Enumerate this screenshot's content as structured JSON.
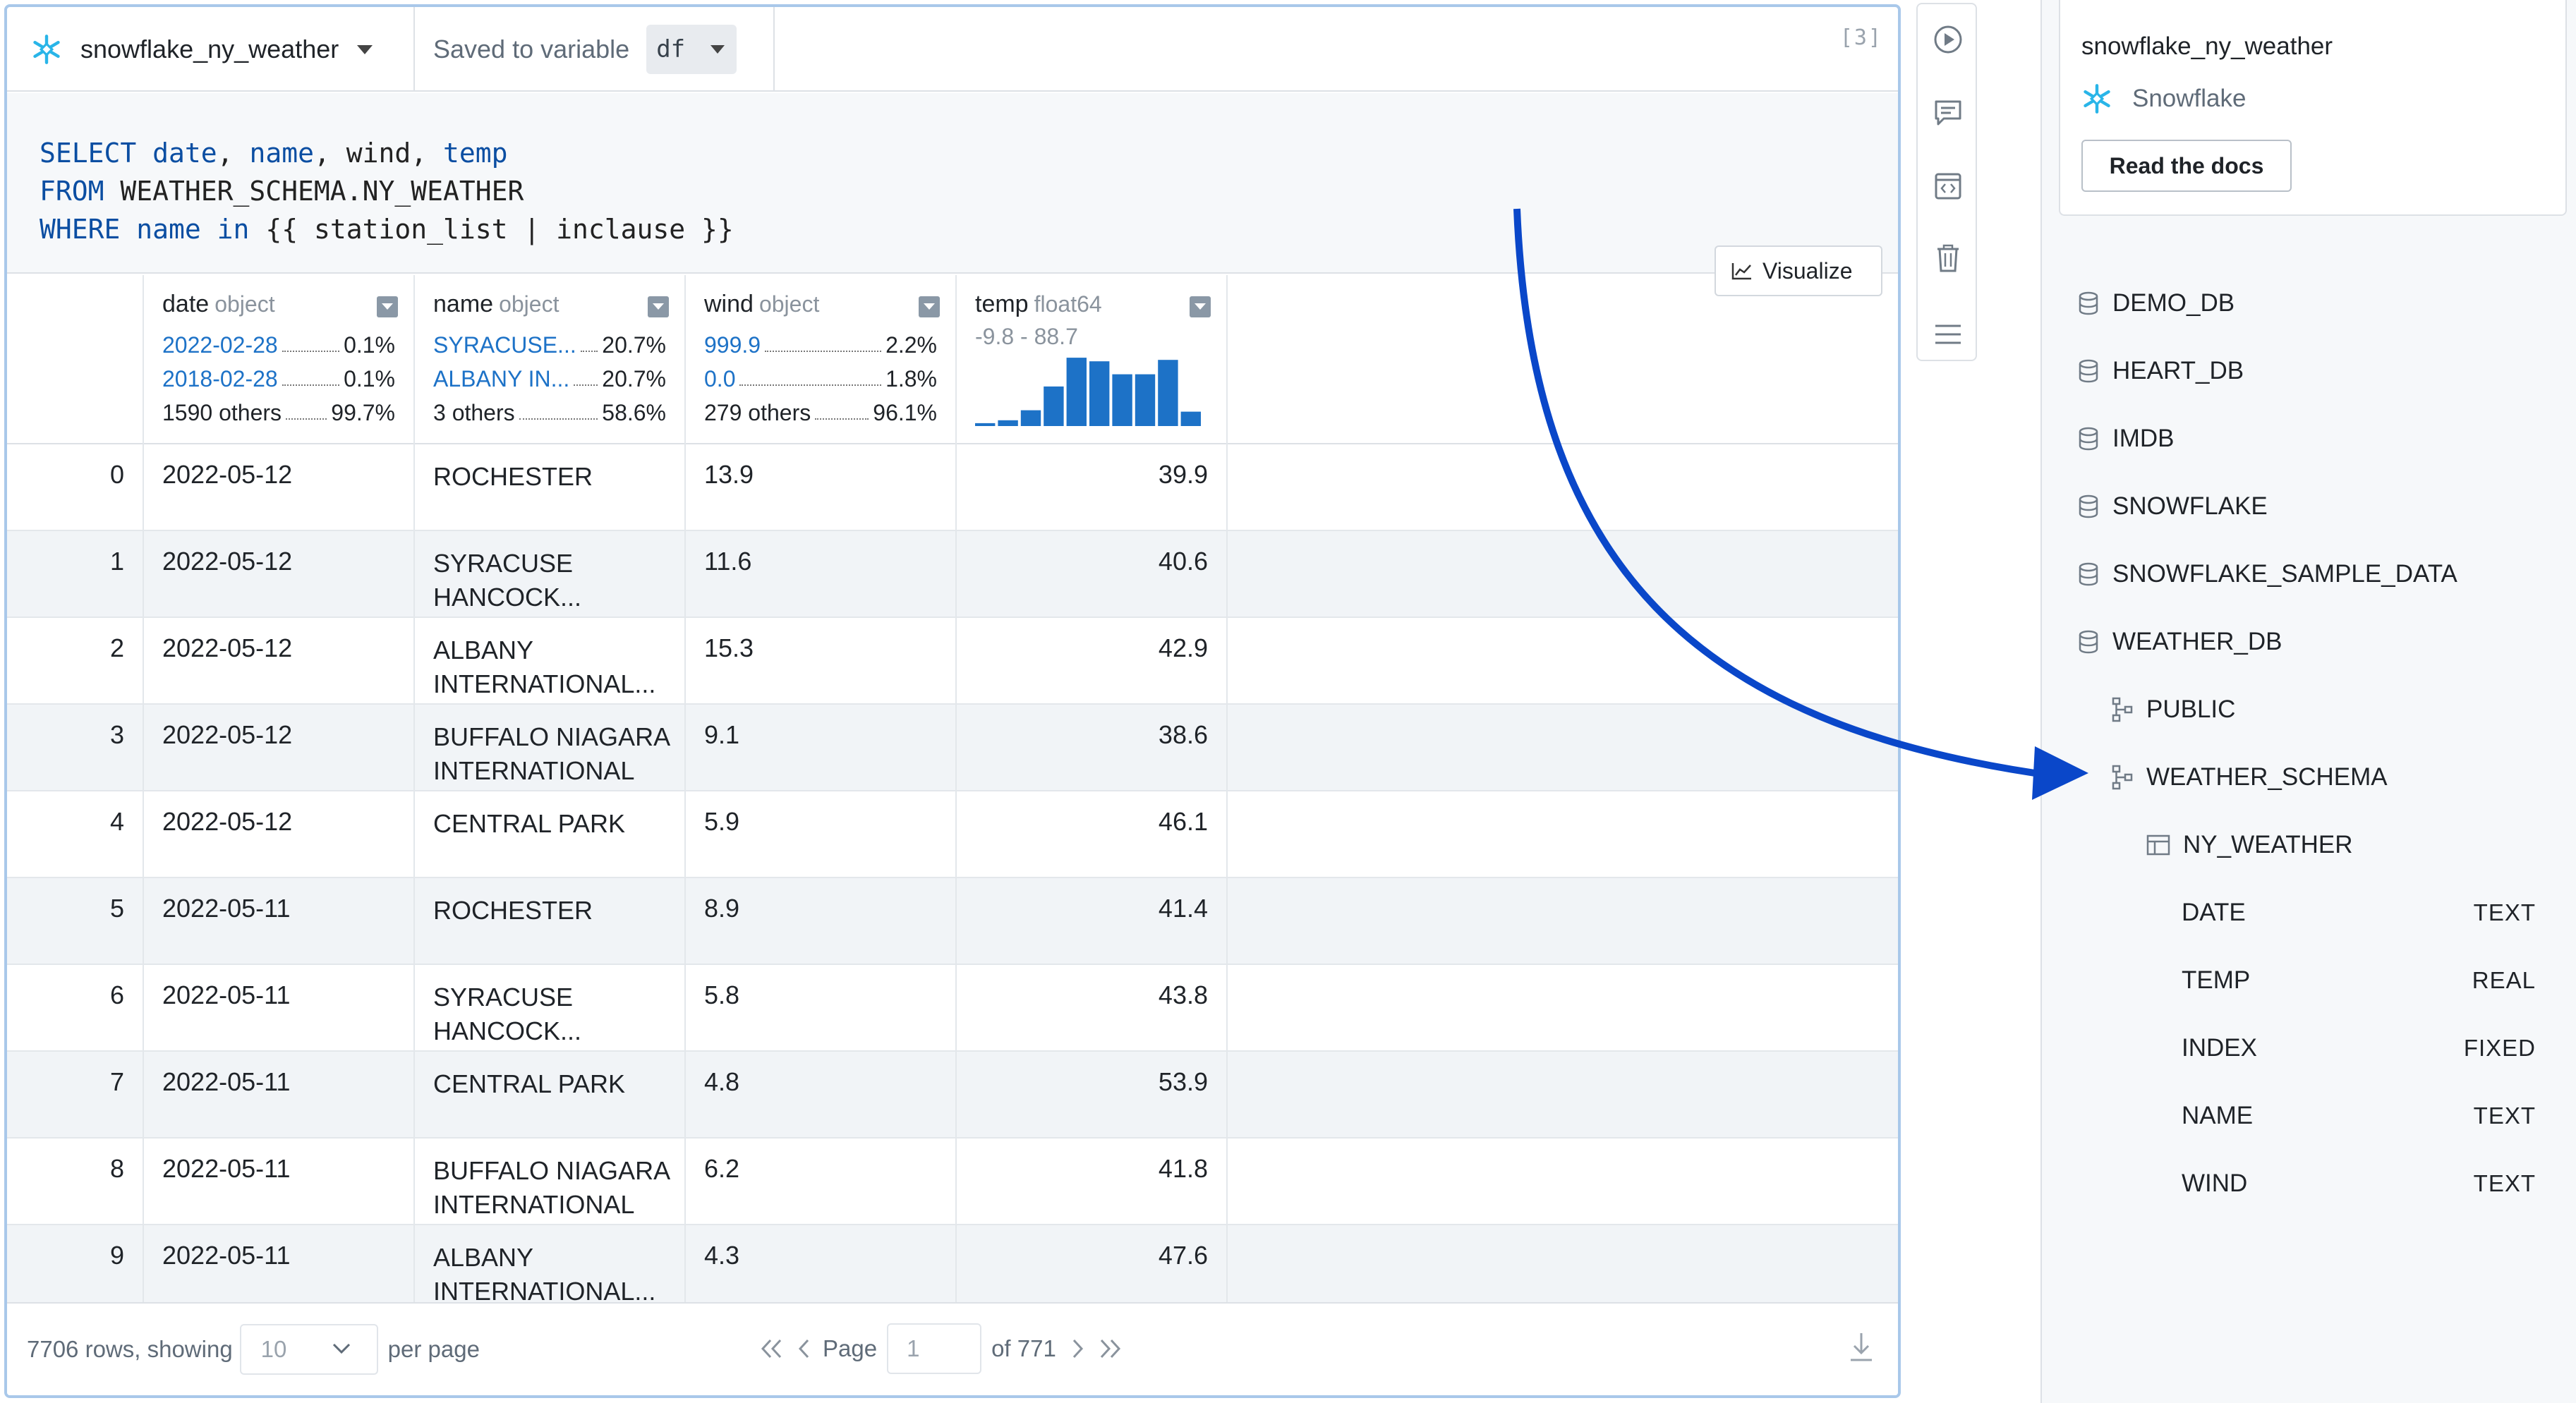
{
  "cell": {
    "source_name": "snowflake_ny_weather",
    "saved_to_label": "Saved to variable",
    "variable": "df",
    "exec_count": "[3]",
    "sql": {
      "line1": [
        "SELECT",
        " date",
        ", ",
        "name",
        ", wind, ",
        "temp"
      ],
      "line2": [
        "FROM",
        " WEATHER_SCHEMA.NY_WEATHER"
      ],
      "line3": [
        "WHERE",
        " name",
        " ",
        "in",
        " {{ station_list | inclause }}"
      ]
    },
    "visualize_label": "Visualize"
  },
  "table": {
    "columns": [
      {
        "name": "date",
        "dtype": "object",
        "stats": [
          {
            "label": "2022-02-28",
            "pct": "0.1%",
            "link": true
          },
          {
            "label": "2018-02-28",
            "pct": "0.1%",
            "link": true
          },
          {
            "label": "1590 others",
            "pct": "99.7%",
            "link": false
          }
        ]
      },
      {
        "name": "name",
        "dtype": "object",
        "stats": [
          {
            "label": "SYRACUSE...",
            "pct": "20.7%",
            "link": true
          },
          {
            "label": "ALBANY IN...",
            "pct": "20.7%",
            "link": true
          },
          {
            "label": "3 others",
            "pct": "58.6%",
            "link": false
          }
        ]
      },
      {
        "name": "wind",
        "dtype": "object",
        "stats": [
          {
            "label": "999.9",
            "pct": "2.2%",
            "link": true
          },
          {
            "label": "0.0",
            "pct": "1.8%",
            "link": true
          },
          {
            "label": "279 others",
            "pct": "96.1%",
            "link": false
          }
        ]
      },
      {
        "name": "temp",
        "dtype": "float64",
        "range": "-9.8 - 88.7"
      }
    ],
    "temp_histogram": [
      0.04,
      0.08,
      0.22,
      0.55,
      0.95,
      0.9,
      0.72,
      0.72,
      0.92,
      0.2
    ],
    "rows": [
      {
        "idx": "0",
        "date": "2022-05-12",
        "name1": "ROCHESTER",
        "name2": "",
        "wind": "13.9",
        "temp": "39.9"
      },
      {
        "idx": "1",
        "date": "2022-05-12",
        "name1": "SYRACUSE",
        "name2": "HANCOCK...",
        "wind": "11.6",
        "temp": "40.6"
      },
      {
        "idx": "2",
        "date": "2022-05-12",
        "name1": "ALBANY",
        "name2": "INTERNATIONAL...",
        "wind": "15.3",
        "temp": "42.9"
      },
      {
        "idx": "3",
        "date": "2022-05-12",
        "name1": "BUFFALO NIAGARA",
        "name2": "INTERNATIONAL",
        "wind": "9.1",
        "temp": "38.6"
      },
      {
        "idx": "4",
        "date": "2022-05-12",
        "name1": "CENTRAL PARK",
        "name2": "",
        "wind": "5.9",
        "temp": "46.1"
      },
      {
        "idx": "5",
        "date": "2022-05-11",
        "name1": "ROCHESTER",
        "name2": "",
        "wind": "8.9",
        "temp": "41.4"
      },
      {
        "idx": "6",
        "date": "2022-05-11",
        "name1": "SYRACUSE",
        "name2": "HANCOCK...",
        "wind": "5.8",
        "temp": "43.8"
      },
      {
        "idx": "7",
        "date": "2022-05-11",
        "name1": "CENTRAL PARK",
        "name2": "",
        "wind": "4.8",
        "temp": "53.9"
      },
      {
        "idx": "8",
        "date": "2022-05-11",
        "name1": "BUFFALO NIAGARA",
        "name2": "INTERNATIONAL",
        "wind": "6.2",
        "temp": "41.8"
      },
      {
        "idx": "9",
        "date": "2022-05-11",
        "name1": "ALBANY",
        "name2": "INTERNATIONAL...",
        "wind": "4.3",
        "temp": "47.6"
      }
    ],
    "footer": {
      "rows_info": "7706 rows, showing",
      "per_page": "10",
      "per_page_label": "per page",
      "page_label": "Page",
      "page": "1",
      "of_label": "of 771"
    }
  },
  "toolbar": {
    "icons": [
      "run-icon",
      "comment-icon",
      "code-icon",
      "trash-icon",
      "menu-icon"
    ]
  },
  "right_panel": {
    "connection_name": "snowflake_ny_weather",
    "connection_type": "Snowflake",
    "docs_label": "Read the docs",
    "databases": [
      "DEMO_DB",
      "HEART_DB",
      "IMDB",
      "SNOWFLAKE",
      "SNOWFLAKE_SAMPLE_DATA",
      "WEATHER_DB"
    ],
    "schemas": [
      "PUBLIC",
      "WEATHER_SCHEMA"
    ],
    "table": "NY_WEATHER",
    "columns": [
      {
        "name": "DATE",
        "type": "TEXT"
      },
      {
        "name": "TEMP",
        "type": "REAL"
      },
      {
        "name": "INDEX",
        "type": "FIXED"
      },
      {
        "name": "NAME",
        "type": "TEXT"
      },
      {
        "name": "WIND",
        "type": "TEXT"
      }
    ]
  },
  "colors": {
    "accent_blue": "#1d72c7",
    "keyword_blue": "#0b4ea2",
    "arrow_blue": "#0a47c9",
    "snowflake_blue": "#29b5e8",
    "histogram_bar": "#1d72c7"
  }
}
